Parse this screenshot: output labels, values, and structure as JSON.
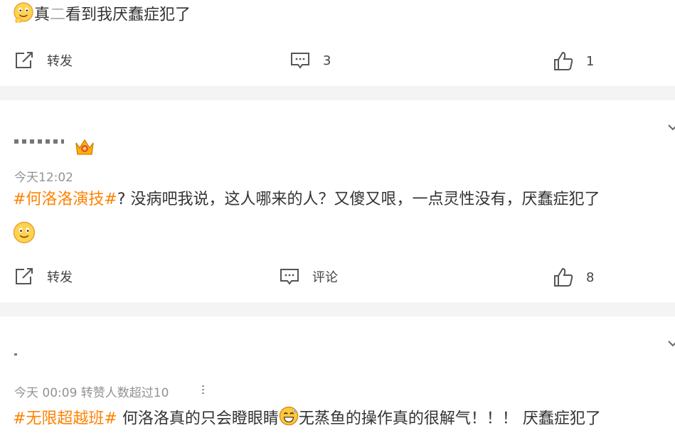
{
  "post1": {
    "text_a": "真",
    "text_hidden": "二",
    "text_b": "看到我厌蠢症犯了",
    "actions": {
      "repost_label": "转发",
      "comment_count": "3",
      "like_count": "1"
    }
  },
  "post2": {
    "time": "今天12:02",
    "topic": "#何洛洛演技#",
    "text": "? 没病吧我说，这人哪来的人？又傻又哏，一点灵性没有，厌蠢症犯了",
    "actions": {
      "repost_label": "转发",
      "comment_label": "评论",
      "like_count": "8"
    }
  },
  "post3": {
    "meta": "今天 00:09 转赞人数超过10",
    "topic": "#无限超越班#",
    "text_a": " 何洛洛真的只会瞪眼睛",
    "text_b": "无蒸鱼的操作真的很解气！！！ 厌蠢症犯了"
  },
  "colors": {
    "topic": "#ff8200",
    "meta": "#939393",
    "divider": "#f4f4f4"
  },
  "icons": [
    "smile-emoji",
    "repost-icon",
    "comment-icon",
    "like-icon",
    "crown-badge-icon",
    "sweat-smile-emoji",
    "chevron-down-icon"
  ]
}
